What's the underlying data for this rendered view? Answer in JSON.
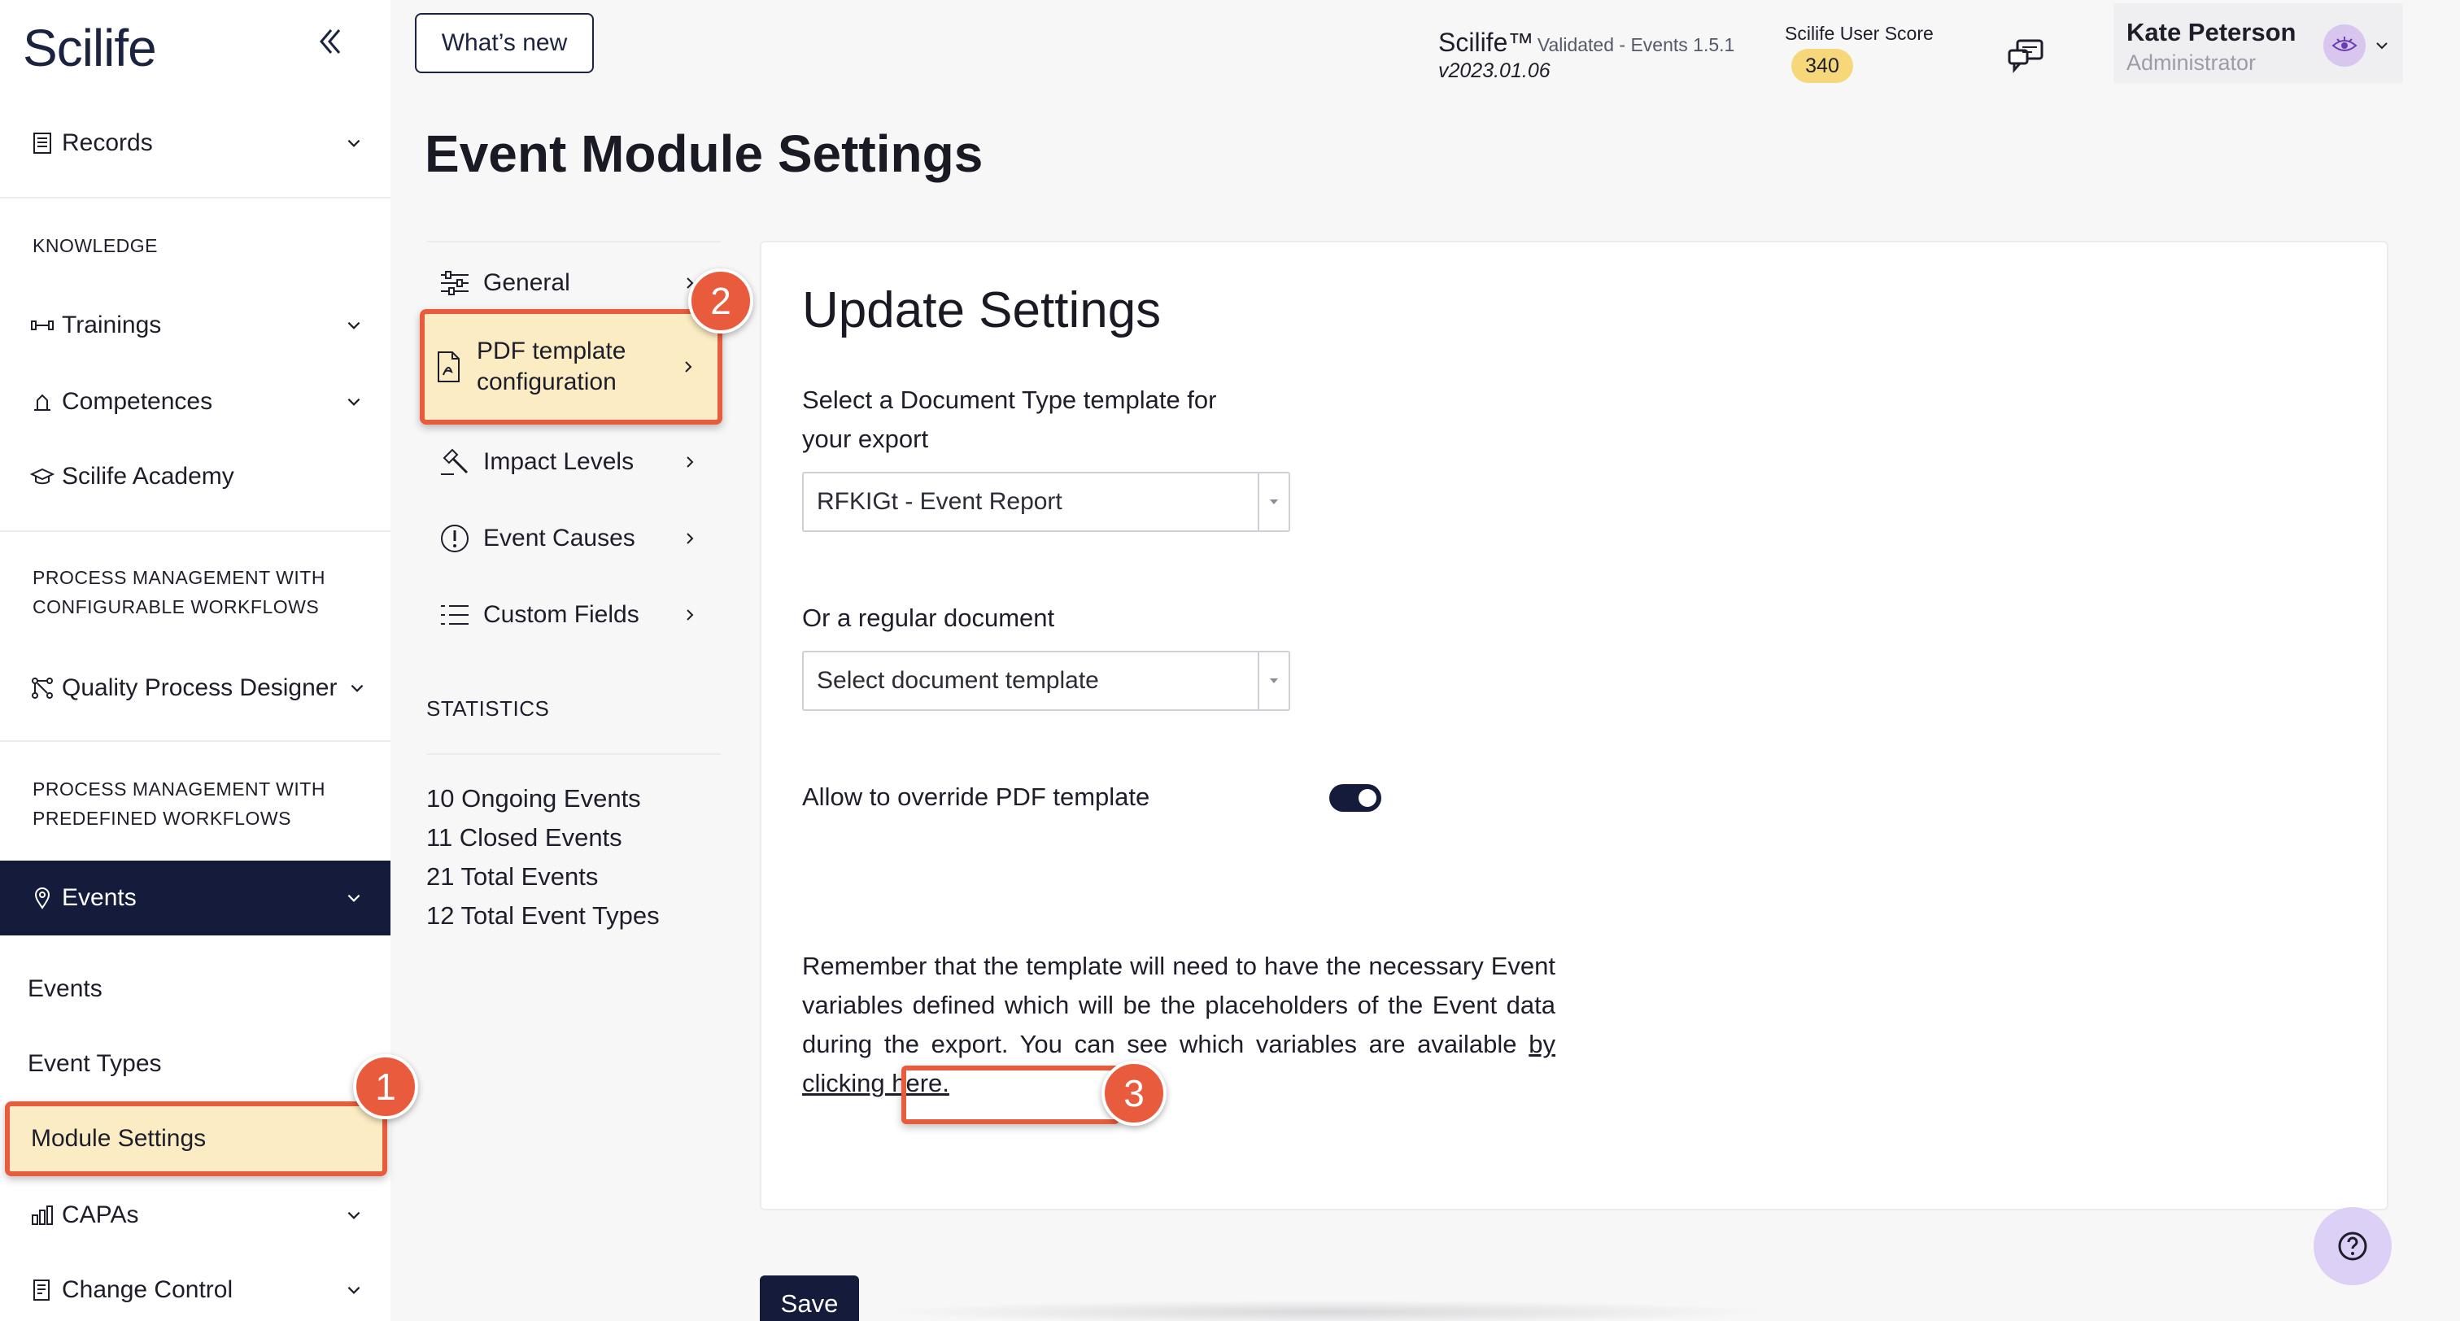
{
  "app": {
    "logo": "Scilife"
  },
  "sidebar": {
    "records": "Records",
    "knowledge_section": "KNOWLEDGE",
    "trainings": "Trainings",
    "competences": "Competences",
    "academy": "Scilife Academy",
    "configurable_section_line1": "PROCESS MANAGEMENT WITH",
    "configurable_section_line2": "CONFIGURABLE WORKFLOWS",
    "quality_process_designer": "Quality Process Designer",
    "predefined_section_line1": "PROCESS MANAGEMENT WITH",
    "predefined_section_line2": "PREDEFINED WORKFLOWS",
    "events": "Events",
    "sub_events": "Events",
    "sub_event_types": "Event Types",
    "sub_module_settings": "Module Settings",
    "capas": "CAPAs",
    "change_control": "Change Control"
  },
  "header": {
    "whats_new": "What’s new",
    "product_name": "Scilife™",
    "validated": "Validated - Events 1.5.1",
    "version": "v2023.01.06",
    "score_label": "Scilife User Score",
    "score_value": "340",
    "user_name": "Kate Peterson",
    "user_role": "Administrator"
  },
  "page": {
    "title": "Event Module Settings"
  },
  "settings_nav": {
    "general": "General",
    "pdf_line1": "PDF template",
    "pdf_line2": "configuration",
    "impact_levels": "Impact Levels",
    "event_causes": "Event Causes",
    "custom_fields": "Custom Fields"
  },
  "statistics": {
    "label": "STATISTICS",
    "items": [
      "10 Ongoing Events",
      "11 Closed Events",
      "21 Total Events",
      "12 Total Event Types"
    ]
  },
  "form": {
    "title": "Update Settings",
    "doc_type_label_line1": "Select a Document Type template for",
    "doc_type_label_line2": "your export",
    "doc_type_value": "RFKIGt - Event Report",
    "regular_doc_label": "Or a regular document",
    "regular_doc_placeholder": "Select document template",
    "override_label": "Allow to override PDF template",
    "override_enabled": true,
    "note_text": "Remember that the template will need to have the necessary Event variables defined which will be the placeholders of the Event data during the export. You can see which variables are available ",
    "note_link": "by clicking here.",
    "save": "Save"
  },
  "annotations": {
    "step1": "1",
    "step2": "2",
    "step3": "3"
  },
  "colors": {
    "accent_navy": "#141b3b",
    "highlight_fill": "#fcecc4",
    "highlight_border": "#e85b3c",
    "score_badge": "#f6d77a",
    "help_bg": "#ddd0f6"
  }
}
